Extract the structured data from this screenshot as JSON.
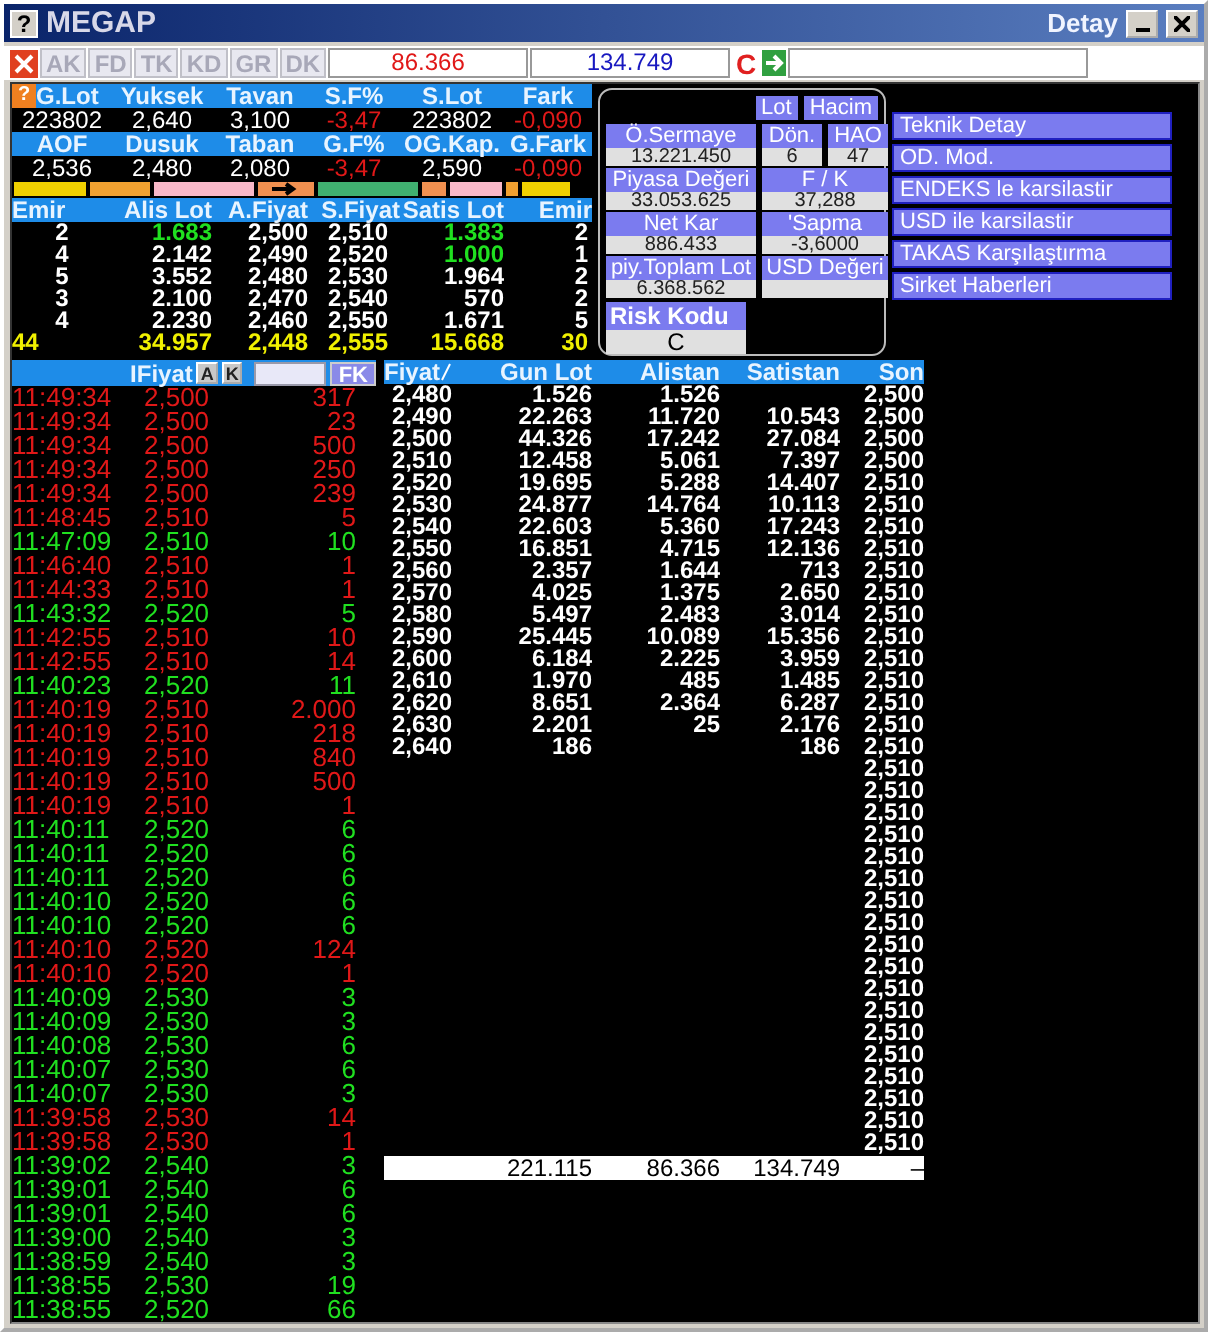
{
  "window": {
    "title": "MEGAP",
    "subtitle": "Detay",
    "help": "?"
  },
  "toolbar": {
    "tabs": [
      {
        "label": "AK",
        "disabled": true
      },
      {
        "label": "FD",
        "disabled": true
      },
      {
        "label": "TK",
        "disabled": true
      },
      {
        "label": "KD",
        "disabled": true
      },
      {
        "label": "GR",
        "disabled": true
      },
      {
        "label": "DK",
        "disabled": true
      }
    ],
    "sell_volume": "86.366",
    "buy_volume": "134.749",
    "flag": "C"
  },
  "summary": {
    "help": "?",
    "rows": [
      {
        "headers": [
          "G.Lot",
          "Yuksek",
          "Tavan",
          "S.F%",
          "S.Lot",
          "Fark"
        ],
        "values": [
          {
            "text": "223802",
            "negative": false
          },
          {
            "text": "2,640",
            "negative": false
          },
          {
            "text": "3,100",
            "negative": false
          },
          {
            "text": "-3,47",
            "negative": true
          },
          {
            "text": "223802",
            "negative": false
          },
          {
            "text": "-0,090",
            "negative": true
          }
        ]
      },
      {
        "headers": [
          "AOF",
          "Dusuk",
          "Taban",
          "G.F%",
          "OG.Kap.",
          "G.Fark"
        ],
        "values": [
          {
            "text": "2,536",
            "negative": false
          },
          {
            "text": "2,480",
            "negative": false
          },
          {
            "text": "2,080",
            "negative": false
          },
          {
            "text": "-3,47",
            "negative": true
          },
          {
            "text": "2,590",
            "negative": false
          },
          {
            "text": "-0,090",
            "negative": true
          }
        ]
      }
    ]
  },
  "order_book": {
    "columns": [
      "Emir",
      "Alis Lot",
      "A.Fiyat",
      "S.Fiyat",
      "Satis Lot",
      "Emir"
    ],
    "rows": [
      {
        "bid_orders": "2",
        "bid_lot": "1.683",
        "bid_updated": true,
        "bid_price": "2,500",
        "ask_price": "2,510",
        "ask_lot": "1.383",
        "ask_updated": true,
        "ask_orders": "2"
      },
      {
        "bid_orders": "4",
        "bid_lot": "2.142",
        "bid_updated": false,
        "bid_price": "2,490",
        "ask_price": "2,520",
        "ask_lot": "1.000",
        "ask_updated": true,
        "ask_orders": "1"
      },
      {
        "bid_orders": "5",
        "bid_lot": "3.552",
        "bid_updated": false,
        "bid_price": "2,480",
        "ask_price": "2,530",
        "ask_lot": "1.964",
        "ask_updated": false,
        "ask_orders": "2"
      },
      {
        "bid_orders": "3",
        "bid_lot": "2.100",
        "bid_updated": false,
        "bid_price": "2,470",
        "ask_price": "2,540",
        "ask_lot": "570",
        "ask_updated": false,
        "ask_orders": "2"
      },
      {
        "bid_orders": "4",
        "bid_lot": "2.230",
        "bid_updated": false,
        "bid_price": "2,460",
        "ask_price": "2,550",
        "ask_lot": "1.671",
        "ask_updated": false,
        "ask_orders": "5"
      }
    ],
    "total": [
      "44",
      "34.957",
      "2,448",
      "2,555",
      "15.668",
      "30"
    ]
  },
  "info_panel": {
    "toggles": [
      "Lot",
      "Hacim"
    ],
    "field_rows": [
      [
        {
          "label": "Ö.Sermaye",
          "value": "13.221.450"
        },
        {
          "label": "Dön.",
          "value": "6"
        },
        {
          "label": "HAO",
          "value": "47"
        }
      ],
      [
        {
          "label": "Piyasa Değeri",
          "value": "33.053.625"
        },
        {
          "label": "F / K",
          "value": "37,288"
        }
      ],
      [
        {
          "label": "Net Kar",
          "value": "886.433"
        },
        {
          "label": "'Sapma",
          "value": "-3,6000"
        }
      ],
      [
        {
          "label": "piy.Toplam Lot",
          "value": "6.368.562"
        },
        {
          "label": "USD Değeri"
        }
      ]
    ],
    "risk": {
      "label": "Risk Kodu",
      "value": "C"
    }
  },
  "menu": [
    "Teknik Detay",
    "OD. Mod.",
    "ENDEKS le karsilastir",
    "USD ile karsilastir",
    "TAKAS Karşılaştırma",
    "Sirket Haberleri"
  ],
  "trades": {
    "header": "IFiyat",
    "buttons": [
      "A",
      "K"
    ],
    "filter_button": "FK",
    "rows": [
      {
        "time": "11:49:34",
        "price": "2,500",
        "lot": "317",
        "uptick": false
      },
      {
        "time": "11:49:34",
        "price": "2,500",
        "lot": "23",
        "uptick": false
      },
      {
        "time": "11:49:34",
        "price": "2,500",
        "lot": "500",
        "uptick": false
      },
      {
        "time": "11:49:34",
        "price": "2,500",
        "lot": "250",
        "uptick": false
      },
      {
        "time": "11:49:34",
        "price": "2,500",
        "lot": "239",
        "uptick": false
      },
      {
        "time": "11:48:45",
        "price": "2,510",
        "lot": "5",
        "uptick": false
      },
      {
        "time": "11:47:09",
        "price": "2,510",
        "lot": "10",
        "uptick": true
      },
      {
        "time": "11:46:40",
        "price": "2,510",
        "lot": "1",
        "uptick": false
      },
      {
        "time": "11:44:33",
        "price": "2,510",
        "lot": "1",
        "uptick": false
      },
      {
        "time": "11:43:32",
        "price": "2,520",
        "lot": "5",
        "uptick": true
      },
      {
        "time": "11:42:55",
        "price": "2,510",
        "lot": "10",
        "uptick": false
      },
      {
        "time": "11:42:55",
        "price": "2,510",
        "lot": "14",
        "uptick": false
      },
      {
        "time": "11:40:23",
        "price": "2,520",
        "lot": "11",
        "uptick": true
      },
      {
        "time": "11:40:19",
        "price": "2,510",
        "lot": "2.000",
        "uptick": false
      },
      {
        "time": "11:40:19",
        "price": "2,510",
        "lot": "218",
        "uptick": false
      },
      {
        "time": "11:40:19",
        "price": "2,510",
        "lot": "840",
        "uptick": false
      },
      {
        "time": "11:40:19",
        "price": "2,510",
        "lot": "500",
        "uptick": false
      },
      {
        "time": "11:40:19",
        "price": "2,510",
        "lot": "1",
        "uptick": false
      },
      {
        "time": "11:40:11",
        "price": "2,520",
        "lot": "6",
        "uptick": true
      },
      {
        "time": "11:40:11",
        "price": "2,520",
        "lot": "6",
        "uptick": true
      },
      {
        "time": "11:40:11",
        "price": "2,520",
        "lot": "6",
        "uptick": true
      },
      {
        "time": "11:40:10",
        "price": "2,520",
        "lot": "6",
        "uptick": true
      },
      {
        "time": "11:40:10",
        "price": "2,520",
        "lot": "6",
        "uptick": true
      },
      {
        "time": "11:40:10",
        "price": "2,520",
        "lot": "124",
        "uptick": false
      },
      {
        "time": "11:40:10",
        "price": "2,520",
        "lot": "1",
        "uptick": false
      },
      {
        "time": "11:40:09",
        "price": "2,530",
        "lot": "3",
        "uptick": true
      },
      {
        "time": "11:40:09",
        "price": "2,530",
        "lot": "3",
        "uptick": true
      },
      {
        "time": "11:40:08",
        "price": "2,530",
        "lot": "6",
        "uptick": true
      },
      {
        "time": "11:40:07",
        "price": "2,530",
        "lot": "6",
        "uptick": true
      },
      {
        "time": "11:40:07",
        "price": "2,530",
        "lot": "3",
        "uptick": true
      },
      {
        "time": "11:39:58",
        "price": "2,530",
        "lot": "14",
        "uptick": false
      },
      {
        "time": "11:39:58",
        "price": "2,530",
        "lot": "1",
        "uptick": false
      },
      {
        "time": "11:39:02",
        "price": "2,540",
        "lot": "3",
        "uptick": true
      },
      {
        "time": "11:39:01",
        "price": "2,540",
        "lot": "6",
        "uptick": true
      },
      {
        "time": "11:39:01",
        "price": "2,540",
        "lot": "6",
        "uptick": true
      },
      {
        "time": "11:39:00",
        "price": "2,540",
        "lot": "3",
        "uptick": true
      },
      {
        "time": "11:38:59",
        "price": "2,540",
        "lot": "3",
        "uptick": true
      },
      {
        "time": "11:38:55",
        "price": "2,530",
        "lot": "19",
        "uptick": true
      },
      {
        "time": "11:38:55",
        "price": "2,520",
        "lot": "66",
        "uptick": true
      }
    ]
  },
  "price_table": {
    "columns": [
      "Fiyat",
      "Gun Lot",
      "Alistan",
      "Satistan",
      "Son"
    ],
    "rows": [
      [
        "2,480",
        "1.526",
        "1.526",
        null
      ],
      [
        "2,490",
        "22.263",
        "11.720",
        "10.543"
      ],
      [
        "2,500",
        "44.326",
        "17.242",
        "27.084"
      ],
      [
        "2,510",
        "12.458",
        "5.061",
        "7.397"
      ],
      [
        "2,520",
        "19.695",
        "5.288",
        "14.407"
      ],
      [
        "2,530",
        "24.877",
        "14.764",
        "10.113"
      ],
      [
        "2,540",
        "22.603",
        "5.360",
        "17.243"
      ],
      [
        "2,550",
        "16.851",
        "4.715",
        "12.136"
      ],
      [
        "2,560",
        "2.357",
        "1.644",
        "713"
      ],
      [
        "2,570",
        "4.025",
        "1.375",
        "2.650"
      ],
      [
        "2,580",
        "5.497",
        "2.483",
        "3.014"
      ],
      [
        "2,590",
        "25.445",
        "10.089",
        "15.356"
      ],
      [
        "2,600",
        "6.184",
        "2.225",
        "3.959"
      ],
      [
        "2,610",
        "1.970",
        "485",
        "1.485"
      ],
      [
        "2,620",
        "8.651",
        "2.364",
        "6.287"
      ],
      [
        "2,630",
        "2.201",
        "25",
        "2.176"
      ],
      [
        "2,640",
        "186",
        null,
        "186"
      ]
    ],
    "last_prices": [
      "2,500",
      "2,500",
      "2,500",
      "2,500",
      "2,510",
      "2,510",
      "2,510",
      "2,510",
      "2,510",
      "2,510",
      "2,510",
      "2,510",
      "2,510",
      "2,510",
      "2,510",
      "2,510",
      "2,510",
      "2,510",
      "2,510",
      "2,510",
      "2,510",
      "2,510",
      "2,510",
      "2,510",
      "2,510",
      "2,510",
      "2,510",
      "2,510",
      "2,510",
      "2,510",
      "2,510",
      "2,510",
      "2,510",
      "2,510",
      "2,510"
    ],
    "totals": [
      "221.115",
      "86.366",
      "134.749",
      "–"
    ]
  }
}
